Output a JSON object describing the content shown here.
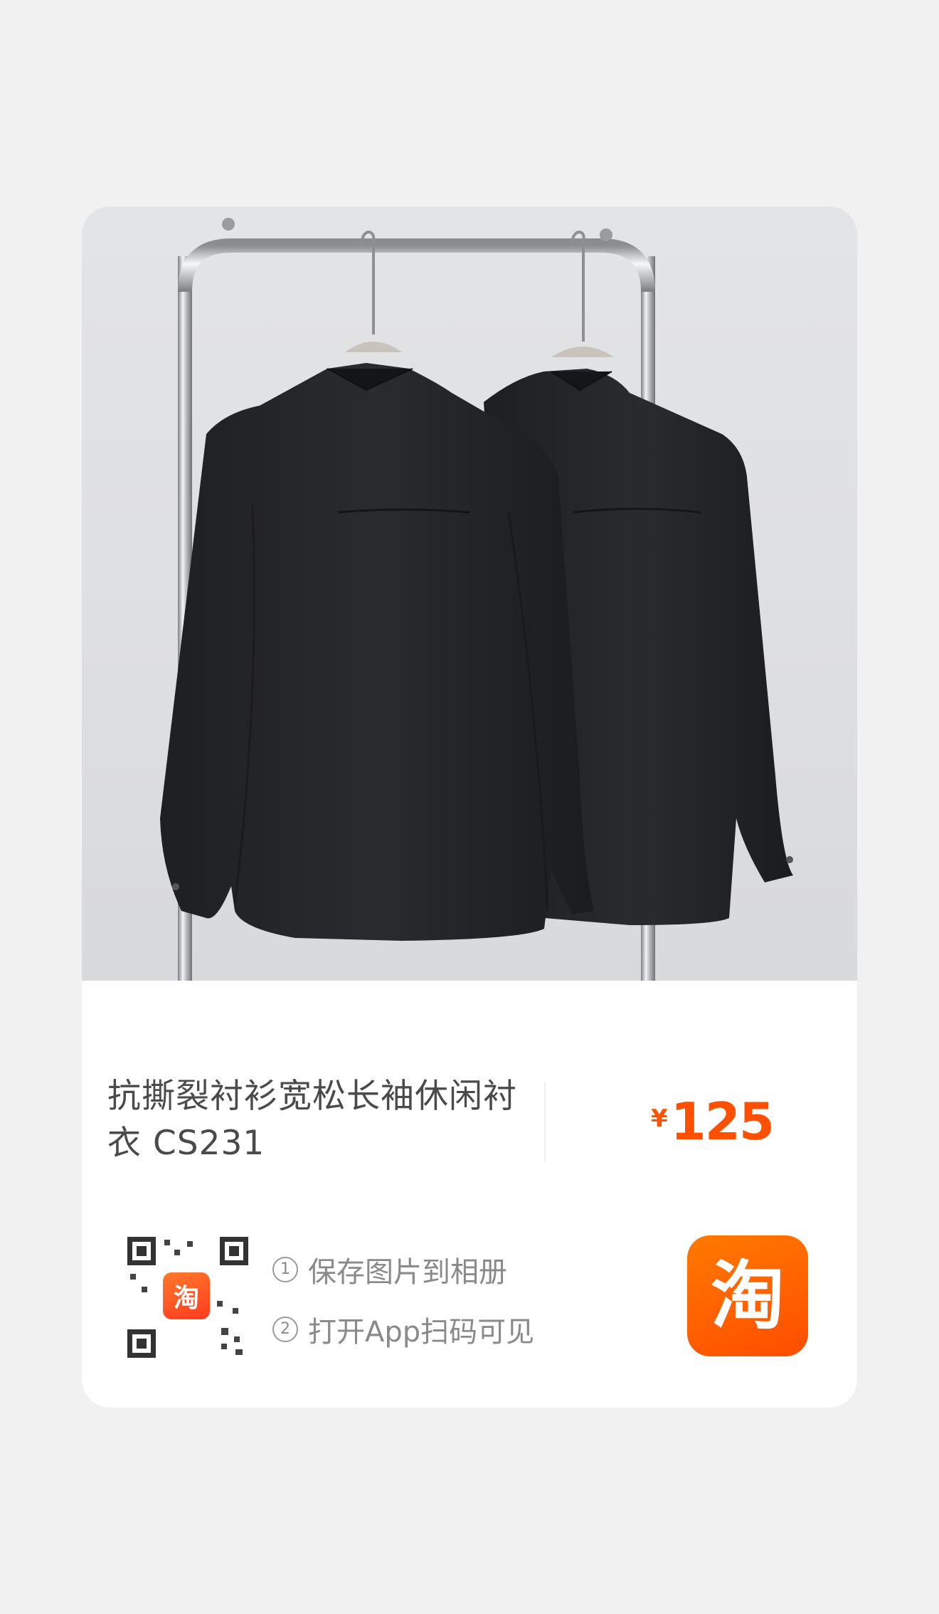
{
  "product": {
    "title_line1": "抗撕裂衬衫宽松长袖休闲衬",
    "title_line2": "衣 CS231",
    "price_symbol": "¥",
    "price": "125",
    "price_color": "#ff5000"
  },
  "share": {
    "step1_num": "1",
    "step1": "保存图片到相册",
    "step2_num": "2",
    "step2": "打开App扫码可见",
    "qr_logo_char": "淘",
    "app_logo_char": "淘",
    "app_color": "#ff5000"
  }
}
